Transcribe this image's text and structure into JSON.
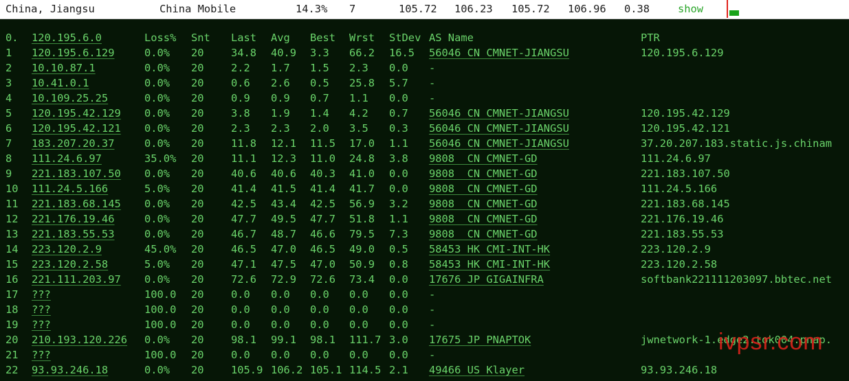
{
  "summary": {
    "location": "China, Jiangsu",
    "carrier": "China Mobile",
    "loss": "14.3%",
    "hops": "7",
    "last": "105.72",
    "avg": "106.23",
    "best": "105.72",
    "worst": "106.96",
    "stdev": "0.38",
    "show_label": "show"
  },
  "columns": [
    "0.",
    "120.195.6.0",
    "Loss%",
    "Snt",
    "Last",
    "Avg",
    "Best",
    "Wrst",
    "StDev",
    "AS Name",
    "PTR"
  ],
  "rows": [
    [
      "1",
      "120.195.6.129",
      "0.0%",
      "20",
      "34.8",
      "40.9",
      "3.3",
      "66.2",
      "16.5",
      "56046 CN CMNET-JIANGSU",
      "120.195.6.129"
    ],
    [
      "2",
      "10.10.87.1",
      "0.0%",
      "20",
      "2.2",
      "1.7",
      "1.5",
      "2.3",
      "0.0",
      "-",
      ""
    ],
    [
      "3",
      "10.41.0.1",
      "0.0%",
      "20",
      "0.6",
      "2.6",
      "0.5",
      "25.8",
      "5.7",
      "-",
      ""
    ],
    [
      "4",
      "10.109.25.25",
      "0.0%",
      "20",
      "0.9",
      "0.9",
      "0.7",
      "1.1",
      "0.0",
      "-",
      ""
    ],
    [
      "5",
      "120.195.42.129",
      "0.0%",
      "20",
      "3.8",
      "1.9",
      "1.4",
      "4.2",
      "0.7",
      "56046 CN CMNET-JIANGSU",
      "120.195.42.129"
    ],
    [
      "6",
      "120.195.42.121",
      "0.0%",
      "20",
      "2.3",
      "2.3",
      "2.0",
      "3.5",
      "0.3",
      "56046 CN CMNET-JIANGSU",
      "120.195.42.121"
    ],
    [
      "7",
      "183.207.20.37",
      "0.0%",
      "20",
      "11.8",
      "12.1",
      "11.5",
      "17.0",
      "1.1",
      "56046 CN CMNET-JIANGSU",
      "37.20.207.183.static.js.chinam"
    ],
    [
      "8",
      "111.24.6.97",
      "35.0%",
      "20",
      "11.1",
      "12.3",
      "11.0",
      "24.8",
      "3.8",
      "9808  CN CMNET-GD",
      "111.24.6.97"
    ],
    [
      "9",
      "221.183.107.50",
      "0.0%",
      "20",
      "40.6",
      "40.6",
      "40.3",
      "41.0",
      "0.0",
      "9808  CN CMNET-GD",
      "221.183.107.50"
    ],
    [
      "10",
      "111.24.5.166",
      "5.0%",
      "20",
      "41.4",
      "41.5",
      "41.4",
      "41.7",
      "0.0",
      "9808  CN CMNET-GD",
      "111.24.5.166"
    ],
    [
      "11",
      "221.183.68.145",
      "0.0%",
      "20",
      "42.5",
      "43.4",
      "42.5",
      "56.9",
      "3.2",
      "9808  CN CMNET-GD",
      "221.183.68.145"
    ],
    [
      "12",
      "221.176.19.46",
      "0.0%",
      "20",
      "47.7",
      "49.5",
      "47.7",
      "51.8",
      "1.1",
      "9808  CN CMNET-GD",
      "221.176.19.46"
    ],
    [
      "13",
      "221.183.55.53",
      "0.0%",
      "20",
      "46.7",
      "48.7",
      "46.6",
      "79.5",
      "7.3",
      "9808  CN CMNET-GD",
      "221.183.55.53"
    ],
    [
      "14",
      "223.120.2.9",
      "45.0%",
      "20",
      "46.5",
      "47.0",
      "46.5",
      "49.0",
      "0.5",
      "58453 HK CMI-INT-HK",
      "223.120.2.9"
    ],
    [
      "15",
      "223.120.2.58",
      "5.0%",
      "20",
      "47.1",
      "47.5",
      "47.0",
      "50.9",
      "0.8",
      "58453 HK CMI-INT-HK",
      "223.120.2.58"
    ],
    [
      "16",
      "221.111.203.97",
      "0.0%",
      "20",
      "72.6",
      "72.9",
      "72.6",
      "73.4",
      "0.0",
      "17676 JP GIGAINFRA",
      "softbank221111203097.bbtec.net"
    ],
    [
      "17",
      "???",
      "100.0",
      "20",
      "0.0",
      "0.0",
      "0.0",
      "0.0",
      "0.0",
      "-",
      ""
    ],
    [
      "18",
      "???",
      "100.0",
      "20",
      "0.0",
      "0.0",
      "0.0",
      "0.0",
      "0.0",
      "-",
      ""
    ],
    [
      "19",
      "???",
      "100.0",
      "20",
      "0.0",
      "0.0",
      "0.0",
      "0.0",
      "0.0",
      "-",
      ""
    ],
    [
      "20",
      "210.193.120.226",
      "0.0%",
      "20",
      "98.1",
      "99.1",
      "98.1",
      "111.7",
      "3.0",
      "17675 JP PNAPTOK",
      "jwnetwork-1.edge2.tok004.pnap."
    ],
    [
      "21",
      "???",
      "100.0",
      "20",
      "0.0",
      "0.0",
      "0.0",
      "0.0",
      "0.0",
      "-",
      ""
    ],
    [
      "22",
      "93.93.246.18",
      "0.0%",
      "20",
      "105.9",
      "106.2",
      "105.1",
      "114.5",
      "2.1",
      "49466 US Klayer",
      "93.93.246.18"
    ]
  ],
  "watermark": "ivpsr.com",
  "colors": {
    "background": "#061606",
    "text": "#6ad46a",
    "summary_bg": "#ffffff",
    "show_link": "#2aa52a",
    "watermark": "#d8231c"
  }
}
